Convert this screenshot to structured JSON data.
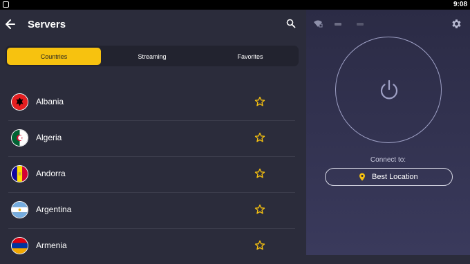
{
  "status_bar": {
    "time": "9:08"
  },
  "header": {
    "title": "Servers"
  },
  "tabs": [
    {
      "label": "Countries",
      "active": true
    },
    {
      "label": "Streaming",
      "active": false
    },
    {
      "label": "Favorites",
      "active": false
    }
  ],
  "countries": [
    {
      "name": "Albania",
      "flag": "albania-flag-icon"
    },
    {
      "name": "Algeria",
      "flag": "algeria-flag-icon"
    },
    {
      "name": "Andorra",
      "flag": "andorra-flag-icon"
    },
    {
      "name": "Argentina",
      "flag": "argentina-flag-icon"
    },
    {
      "name": "Armenia",
      "flag": "armenia-flag-icon"
    }
  ],
  "connect": {
    "label": "Connect to:",
    "location": "Best Location"
  },
  "colors": {
    "accent": "#f7c20f",
    "background": "#2b2c3b",
    "panel": "#2b2b45"
  }
}
